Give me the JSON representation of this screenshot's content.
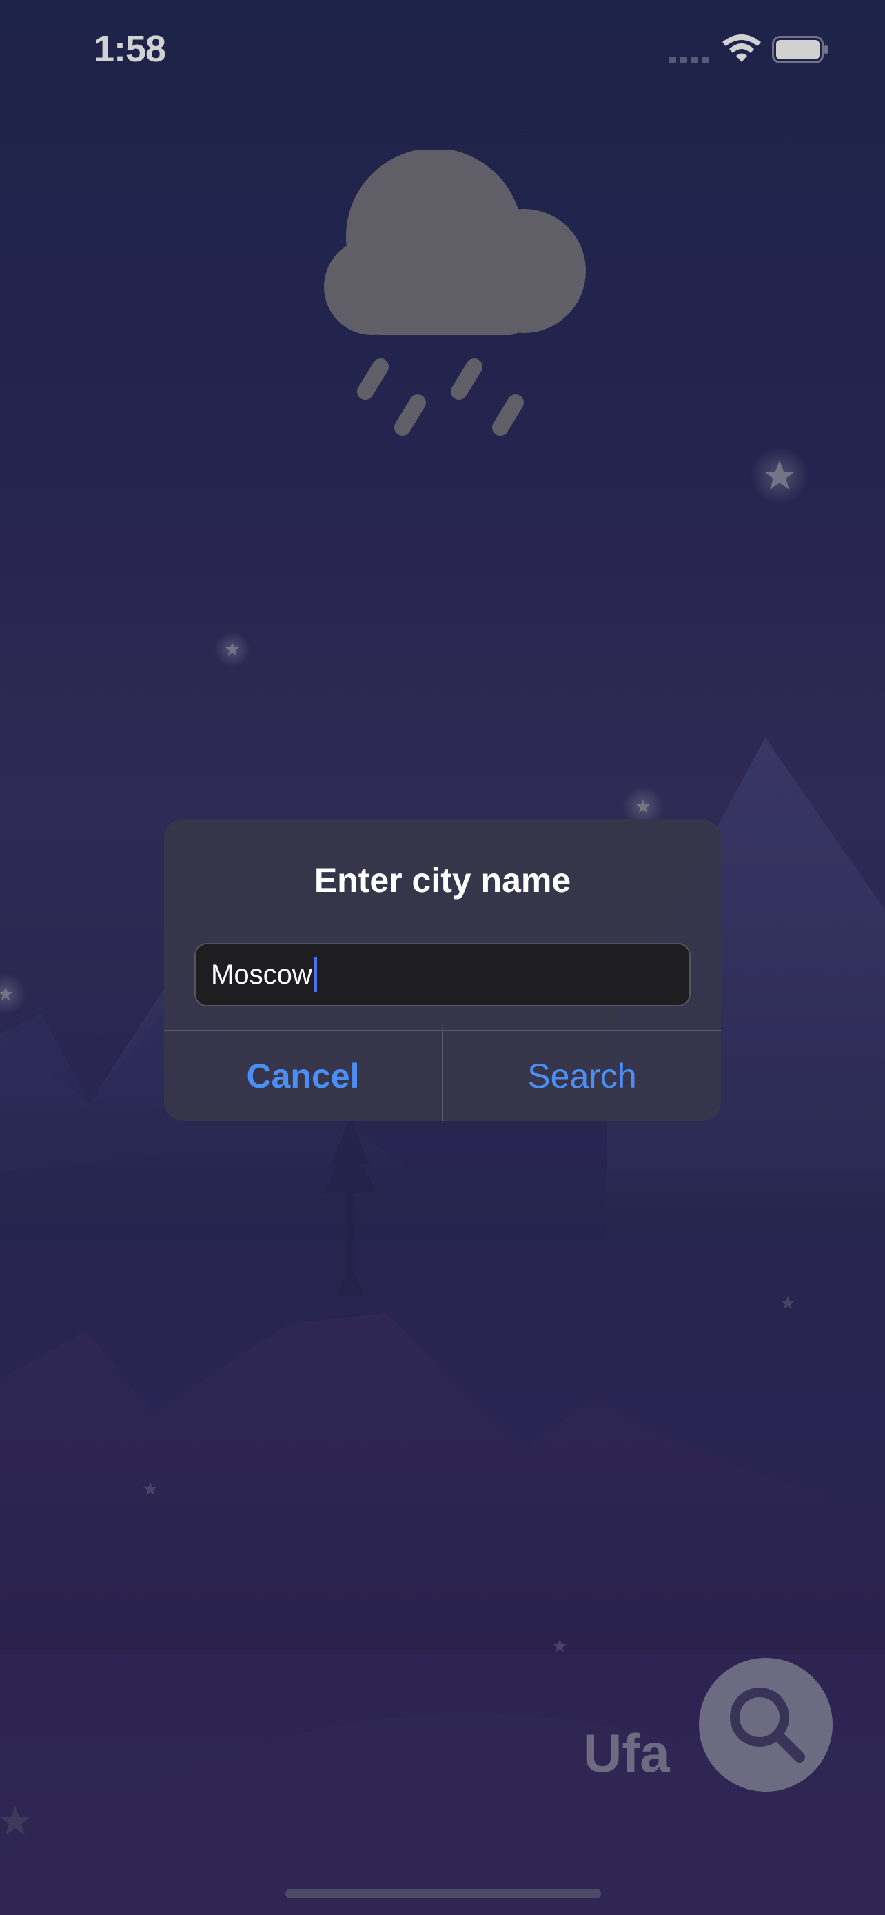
{
  "status_bar": {
    "time": "1:58",
    "signal_icon": "signal-bars-icon",
    "wifi_icon": "wifi-icon",
    "battery_icon": "battery-full-icon"
  },
  "weather": {
    "icon": "cloud-rain-icon",
    "icon_color": "#76757f"
  },
  "dialog": {
    "title": "Enter city name",
    "input_value": "Moscow",
    "cancel_label": "Cancel",
    "search_label": "Search",
    "button_color": "#4a8ff5"
  },
  "location": {
    "city": "Ufa",
    "search_button_icon": "magnifying-glass-icon"
  },
  "colors": {
    "background_top": "#252b59",
    "background_bottom": "#3a2f66",
    "dialog_background": "#38364a",
    "accent": "#4a8ff5"
  }
}
